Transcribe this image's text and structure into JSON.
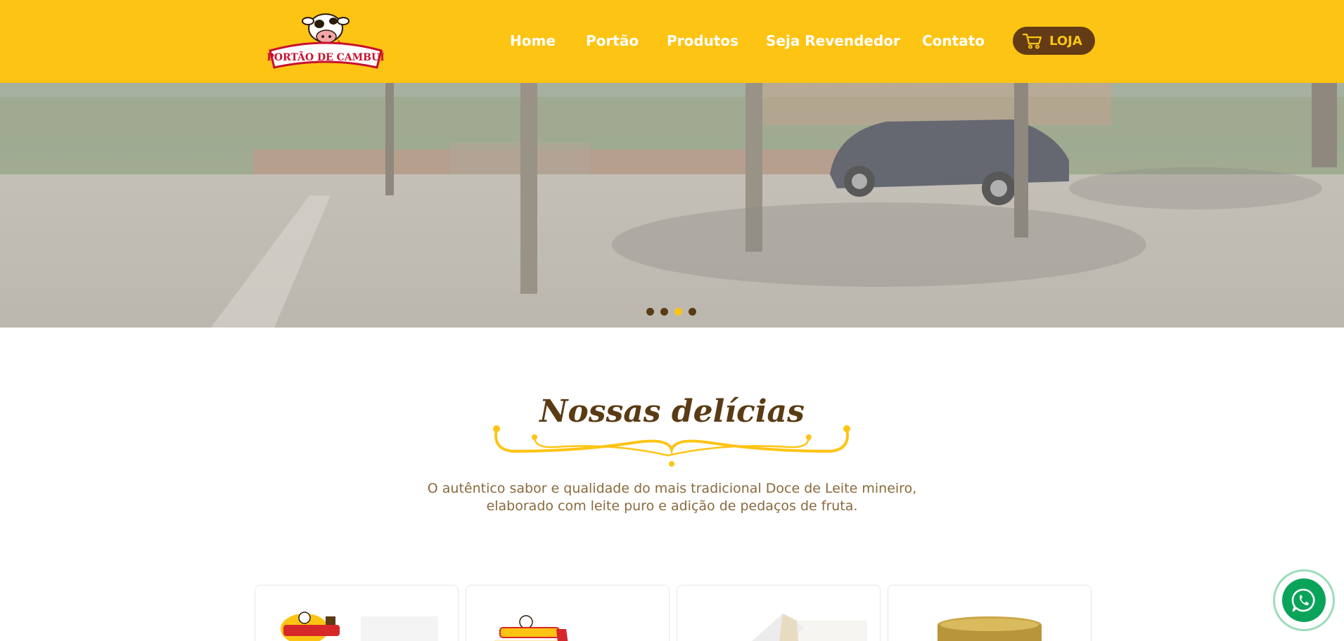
{
  "brand": {
    "logo_text": "PORTÃO DE CAMBUÍ",
    "colors": {
      "primary": "#fec414",
      "brown": "#633c15",
      "text_brown": "#5a3b14",
      "desc": "#8a6a3c",
      "whatsapp": "#0aa35a"
    }
  },
  "nav": {
    "items": [
      {
        "label": "Home"
      },
      {
        "label": "Portão"
      },
      {
        "label": "Produtos"
      },
      {
        "label": "Seja Revendedor"
      },
      {
        "label": "Contato"
      }
    ],
    "store_button": {
      "label": "LOJA",
      "icon": "shopping-cart-icon"
    }
  },
  "hero": {
    "slides_count": 4,
    "active_slide": 3
  },
  "section": {
    "title": "Nossas delícias",
    "description_line1": "O autêntico sabor e qualidade do mais tradicional Doce de Leite mineiro,",
    "description_line2": "elaborado com leite puro e adição de pedaços de fruta."
  },
  "products": [
    {
      "name": "product-card-1"
    },
    {
      "name": "product-card-2"
    },
    {
      "name": "product-card-3"
    },
    {
      "name": "product-card-4"
    }
  ],
  "whatsapp": {
    "icon": "whatsapp-icon"
  }
}
